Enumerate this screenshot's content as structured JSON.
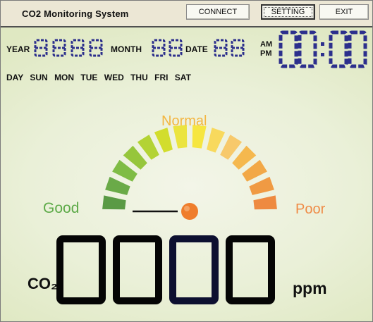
{
  "app": {
    "title": "CO2 Monitoring System"
  },
  "toolbar": {
    "connect_label": "CONNECT",
    "setting_label": "SETTING",
    "exit_label": "EXIT"
  },
  "date": {
    "year_label": "YEAR",
    "month_label": "MONTH",
    "date_label": "DATE",
    "am_label": "AM",
    "pm_label": "PM",
    "days_label": "DAY",
    "days": [
      "SUN",
      "MON",
      "TUE",
      "WED",
      "THU",
      "FRI",
      "SAT"
    ]
  },
  "gauge": {
    "good_label": "Good",
    "normal_label": "Normal",
    "poor_label": "Poor"
  },
  "reading": {
    "co2_label": "CO₂",
    "unit_label": "ppm"
  },
  "colors": {
    "good": "#5daa48",
    "normal": "#f3b640",
    "poor": "#ef8b46",
    "indicator": "#ef7d2c"
  }
}
